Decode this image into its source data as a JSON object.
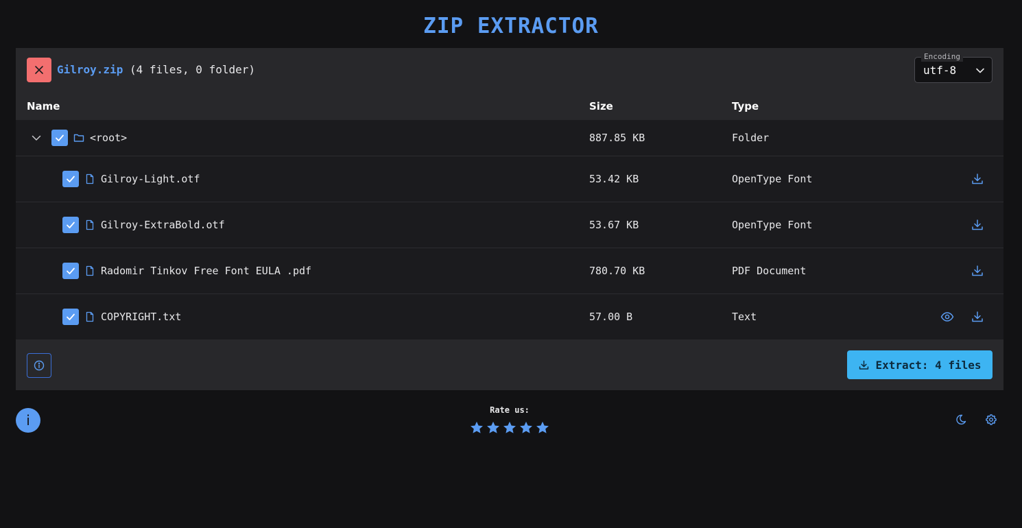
{
  "app": {
    "title": "ZIP EXTRACTOR"
  },
  "archive": {
    "name": "Gilroy.zip",
    "summary": "(4 files, 0 folder)"
  },
  "encoding": {
    "legend": "Encoding",
    "value": "utf-8"
  },
  "table": {
    "headers": {
      "name": "Name",
      "size": "Size",
      "type": "Type"
    },
    "root": {
      "name": "<root>",
      "size": "887.85 KB",
      "type": "Folder"
    },
    "files": [
      {
        "name": "Gilroy-Light.otf",
        "size": "53.42 KB",
        "type": "OpenType Font",
        "checked": true
      },
      {
        "name": "Gilroy-ExtraBold.otf",
        "size": "53.67 KB",
        "type": "OpenType Font",
        "checked": true
      },
      {
        "name": "Radomir Tinkov Free Font EULA .pdf",
        "size": "780.70 KB",
        "type": "PDF Document",
        "checked": true
      },
      {
        "name": "COPYRIGHT.txt",
        "size": "57.00 B",
        "type": "Text",
        "checked": true,
        "previewable": true
      }
    ]
  },
  "footer": {
    "extract_label": "Extract: 4 files"
  },
  "bottom": {
    "info_label": "i",
    "rate_label": "Rate us:",
    "rating_max": 5
  },
  "colors": {
    "accent": "#5b9cf2",
    "danger": "#f36f6f",
    "extract": "#3db4f2",
    "background": "#121214"
  },
  "icons": [
    "close-icon",
    "chevron-down-icon",
    "folder-icon",
    "file-icon",
    "download-icon",
    "eye-icon",
    "info-icon",
    "star-icon",
    "moon-icon",
    "gear-icon"
  ]
}
